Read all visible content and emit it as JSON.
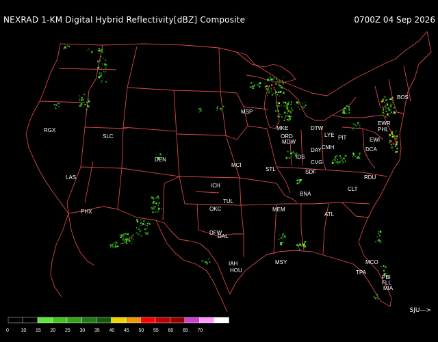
{
  "header": {
    "title": "NEXRAD 1-KM Digital Hybrid Reflectivity[dBZ] Composite",
    "timestamp": "0700Z 04 Sep 2026"
  },
  "nav": {
    "label": "SJU—>"
  },
  "colors": {
    "background": "#000000",
    "boundary": "#d84a4a",
    "text": "#ffffff"
  },
  "stations": [
    {
      "id": "BOS"
    },
    {
      "id": "EWR"
    },
    {
      "id": "PHL"
    },
    {
      "id": "EWI"
    },
    {
      "id": "DCA"
    },
    {
      "id": "LYE"
    },
    {
      "id": "PIT"
    },
    {
      "id": "DTW"
    },
    {
      "id": "MKE"
    },
    {
      "id": "ORD"
    },
    {
      "id": "MDW"
    },
    {
      "id": "MSP"
    },
    {
      "id": "DAY"
    },
    {
      "id": "CMH"
    },
    {
      "id": "CVG"
    },
    {
      "id": "SDF"
    },
    {
      "id": "IDS"
    },
    {
      "id": "STL"
    },
    {
      "id": "MCI"
    },
    {
      "id": "ICH"
    },
    {
      "id": "TUL"
    },
    {
      "id": "OKC"
    },
    {
      "id": "DFW"
    },
    {
      "id": "DAL"
    },
    {
      "id": "IAH"
    },
    {
      "id": "HOU"
    },
    {
      "id": "MSY"
    },
    {
      "id": "MEM"
    },
    {
      "id": "BNA"
    },
    {
      "id": "ATL"
    },
    {
      "id": "CLT"
    },
    {
      "id": "RDU"
    },
    {
      "id": "TPA"
    },
    {
      "id": "MCO"
    },
    {
      "id": "PBI"
    },
    {
      "id": "FLL"
    },
    {
      "id": "MIA"
    },
    {
      "id": "DEN"
    },
    {
      "id": "SLC"
    },
    {
      "id": "LAS"
    },
    {
      "id": "PHX"
    },
    {
      "id": "RGX"
    }
  ],
  "legend": {
    "ticks": [
      "0",
      "10",
      "15",
      "20",
      "25",
      "30",
      "35",
      "40",
      "45",
      "50",
      "55",
      "60",
      "65",
      "70"
    ],
    "colors": [
      "#000000",
      "#000000",
      "#5ce63c",
      "#44c21f",
      "#35a11c",
      "#1f7c16",
      "#135a10",
      "#f0d400",
      "#f09a00",
      "#ff0000",
      "#c00000",
      "#940000",
      "#cc44cc",
      "#ff99ff",
      "#ffffff"
    ]
  }
}
